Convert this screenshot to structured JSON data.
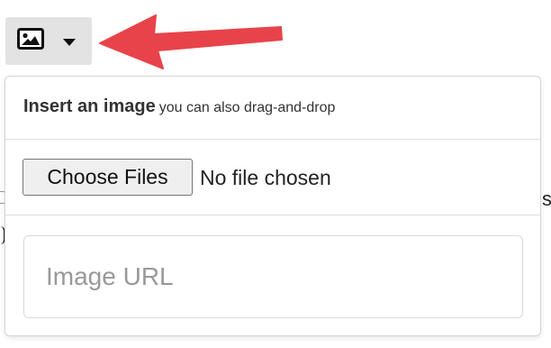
{
  "toolbar": {
    "image_button": {
      "icon": "image-icon",
      "dropdown_icon": "caret-down-icon"
    }
  },
  "annotation": {
    "arrow_color": "#e8434a"
  },
  "popover": {
    "title": "Insert an image",
    "subtitle": "you can also drag-and-drop",
    "choose_files_label": "Choose Files",
    "file_status": "No file chosen",
    "url_placeholder": "Image URL"
  }
}
